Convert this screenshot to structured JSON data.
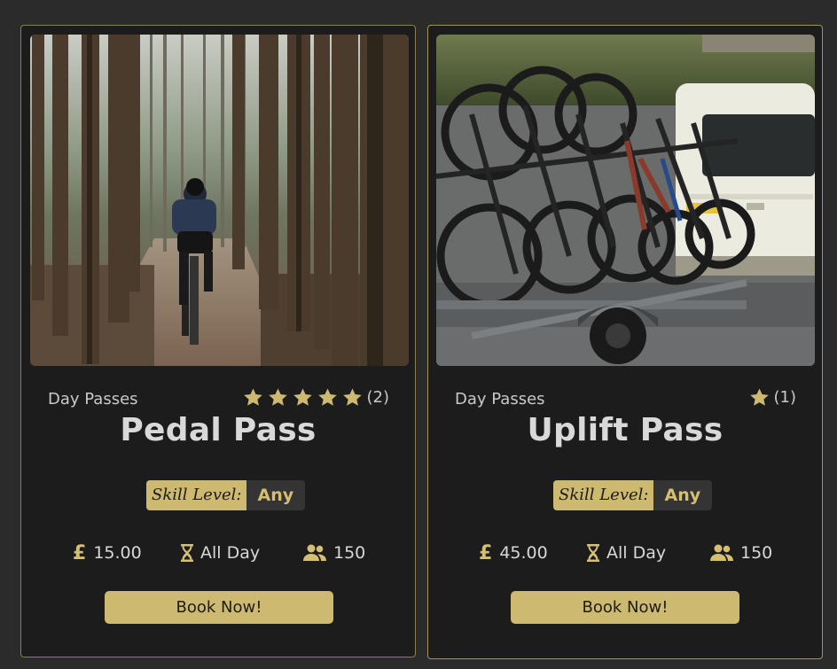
{
  "cards": [
    {
      "category": "Day Passes",
      "rating_stars": 5,
      "rating_count": "(2)",
      "title": "Pedal Pass",
      "skill_label": "Skill Level:",
      "skill_value": "Any",
      "price": "15.00",
      "price_icon": "pound-icon",
      "duration": "All Day",
      "duration_icon": "hourglass-icon",
      "capacity": "150",
      "capacity_icon": "users-icon",
      "button": "Book Now!",
      "image": "forest-cyclist-photo"
    },
    {
      "category": "Day Passes",
      "rating_stars": 1,
      "rating_count": "(1)",
      "title": "Uplift Pass",
      "skill_label": "Skill Level:",
      "skill_value": "Any",
      "price": "45.00",
      "price_icon": "pound-icon",
      "duration": "All Day",
      "duration_icon": "hourglass-icon",
      "capacity": "150",
      "capacity_icon": "users-icon",
      "button": "Book Now!",
      "image": "bike-trailer-van-photo"
    }
  ],
  "colors": {
    "accent": "#cdb96f",
    "card_bg": "#1c1c1c",
    "page_bg": "#2b2b2b"
  },
  "currency_symbol": "£"
}
